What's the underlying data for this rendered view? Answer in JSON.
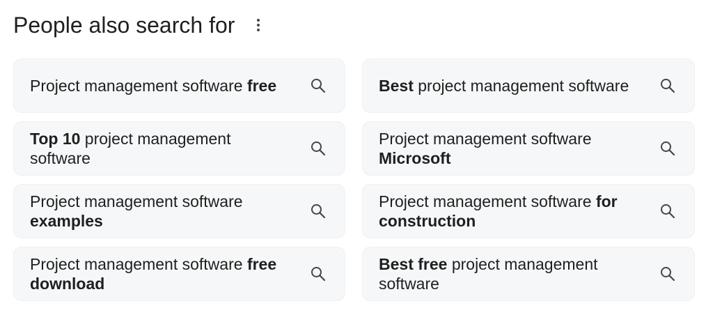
{
  "header": {
    "title": "People also search for",
    "more_icon": "more-vert-icon"
  },
  "suggestions": [
    {
      "parts": [
        {
          "text": "Project management software ",
          "bold": false
        },
        {
          "text": "free",
          "bold": true
        }
      ]
    },
    {
      "parts": [
        {
          "text": "Best",
          "bold": true
        },
        {
          "text": " project management software",
          "bold": false
        }
      ]
    },
    {
      "parts": [
        {
          "text": "Top 10",
          "bold": true
        },
        {
          "text": " project management software",
          "bold": false
        }
      ]
    },
    {
      "parts": [
        {
          "text": "Project management software ",
          "bold": false
        },
        {
          "text": "Microsoft",
          "bold": true
        }
      ]
    },
    {
      "parts": [
        {
          "text": "Project management software ",
          "bold": false
        },
        {
          "text": "examples",
          "bold": true
        }
      ]
    },
    {
      "parts": [
        {
          "text": "Project management software ",
          "bold": false
        },
        {
          "text": "for construction",
          "bold": true
        }
      ]
    },
    {
      "parts": [
        {
          "text": "Project management software ",
          "bold": false
        },
        {
          "text": "free download",
          "bold": true
        }
      ]
    },
    {
      "parts": [
        {
          "text": "Best free",
          "bold": true
        },
        {
          "text": " project management software",
          "bold": false
        }
      ]
    }
  ],
  "icons": {
    "suggestion_icon": "search-icon"
  },
  "colors": {
    "chip_background": "#f6f7f8",
    "text": "#1f1f1f",
    "icon": "#444746"
  }
}
